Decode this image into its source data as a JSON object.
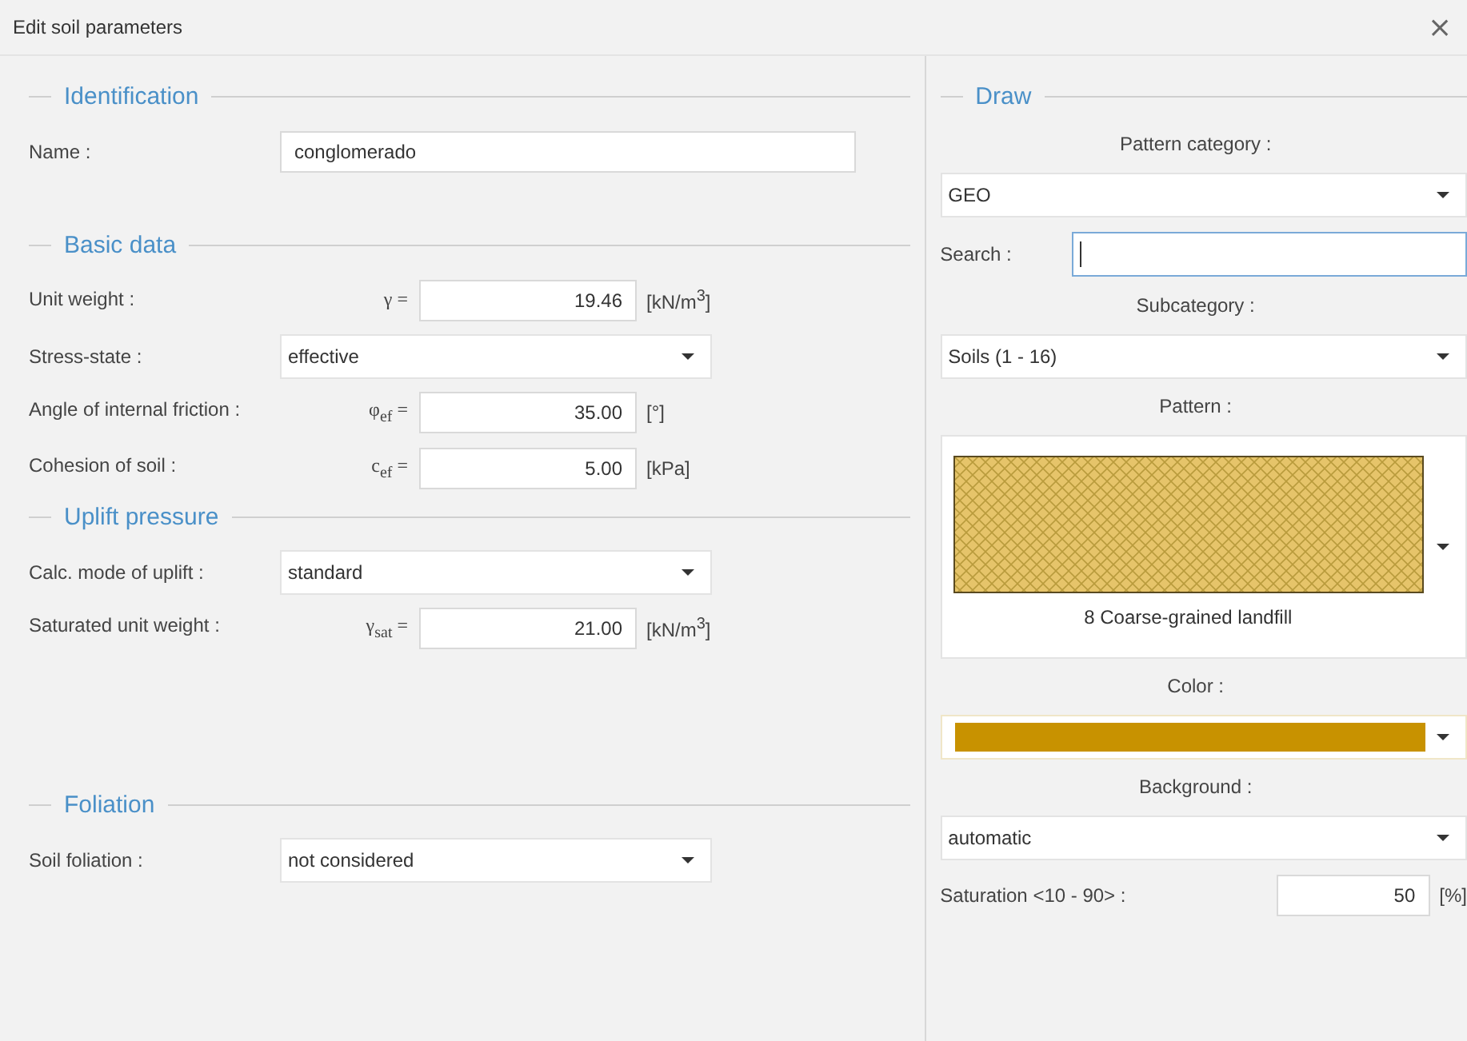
{
  "window": {
    "title": "Edit soil parameters",
    "close": "×"
  },
  "left": [
    {
      "title": "Identification",
      "rows": [
        {
          "kind": "text",
          "label": "Name :",
          "value": "conglomerado"
        }
      ]
    },
    {
      "title": "Basic data",
      "rows": [
        {
          "kind": "number",
          "label": "Unit weight :",
          "symbol": "γ =",
          "value": "19.46",
          "unit": "[kN/m$^{3}$]"
        },
        {
          "kind": "select",
          "label": "Stress-state :",
          "value": "effective"
        },
        {
          "kind": "number",
          "label": "Angle of internal friction :",
          "symbol": "φ$_{ef}$ =",
          "value": "35.00",
          "unit": "[°]"
        },
        {
          "kind": "number",
          "label": "Cohesion of soil :",
          "symbol": "c$_{ef}$ =",
          "value": "5.00",
          "unit": "[kPa]"
        }
      ]
    },
    {
      "title": "Uplift pressure",
      "rows": [
        {
          "kind": "select",
          "label": "Calc. mode of uplift :",
          "value": "standard"
        },
        {
          "kind": "number",
          "label": "Saturated unit weight :",
          "symbol": "γ$_{sat}$ =",
          "value": "21.00",
          "unit": "[kN/m$^{3}$]"
        }
      ]
    },
    {
      "title": "Foliation",
      "rows": [
        {
          "kind": "select",
          "label": "Soil foliation :",
          "value": "not considered"
        }
      ]
    }
  ],
  "right": {
    "title": "Draw",
    "items": [
      {
        "kind": "caption",
        "text": "Pattern category :"
      },
      {
        "kind": "select",
        "value": "GEO"
      },
      {
        "kind": "search",
        "label": "Search :"
      },
      {
        "kind": "caption",
        "text": "Subcategory :"
      },
      {
        "kind": "select",
        "value": "Soils (1 - 16)"
      },
      {
        "kind": "caption",
        "text": "Pattern :"
      },
      {
        "kind": "pattern",
        "value": "8 Coarse-grained landfill"
      },
      {
        "kind": "caption",
        "text": "Color :"
      },
      {
        "kind": "color",
        "color": "#c89200"
      },
      {
        "kind": "caption",
        "text": "Background :"
      },
      {
        "kind": "select",
        "value": "automatic"
      },
      {
        "kind": "number",
        "label": "Saturation <10 - 90> :",
        "value": "50",
        "unit": "[%]"
      }
    ]
  }
}
